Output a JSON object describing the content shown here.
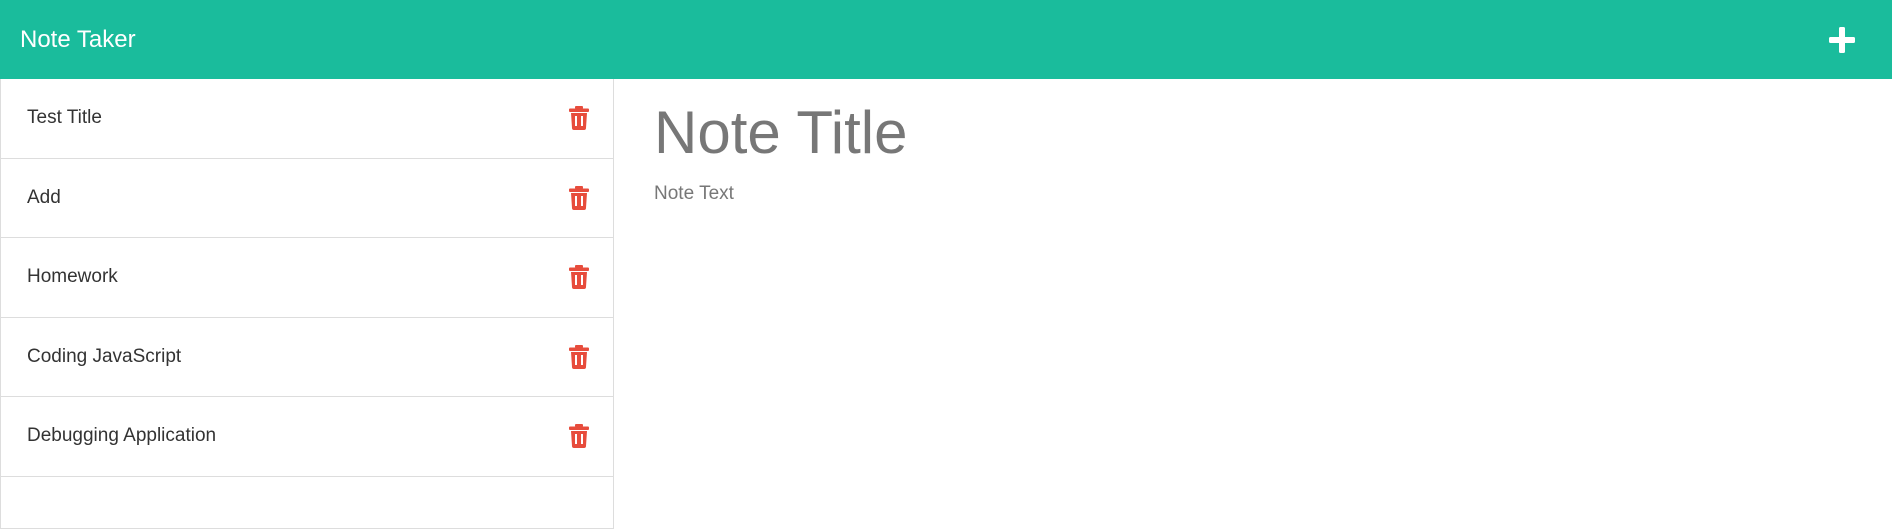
{
  "app": {
    "title": "Note Taker",
    "accent_color": "#1abc9c",
    "delete_color": "#e74c3c"
  },
  "header": {
    "add_icon": "plus-icon"
  },
  "sidebar": {
    "notes": [
      {
        "title": "Test Title",
        "icon": "trash-icon"
      },
      {
        "title": "Add",
        "icon": "trash-icon"
      },
      {
        "title": "Homework",
        "icon": "trash-icon"
      },
      {
        "title": "Coding JavaScript",
        "icon": "trash-icon"
      },
      {
        "title": "Debugging Application",
        "icon": "trash-icon"
      }
    ]
  },
  "editor": {
    "title_placeholder": "Note Title",
    "title_value": "",
    "text_placeholder": "Note Text",
    "text_value": ""
  }
}
